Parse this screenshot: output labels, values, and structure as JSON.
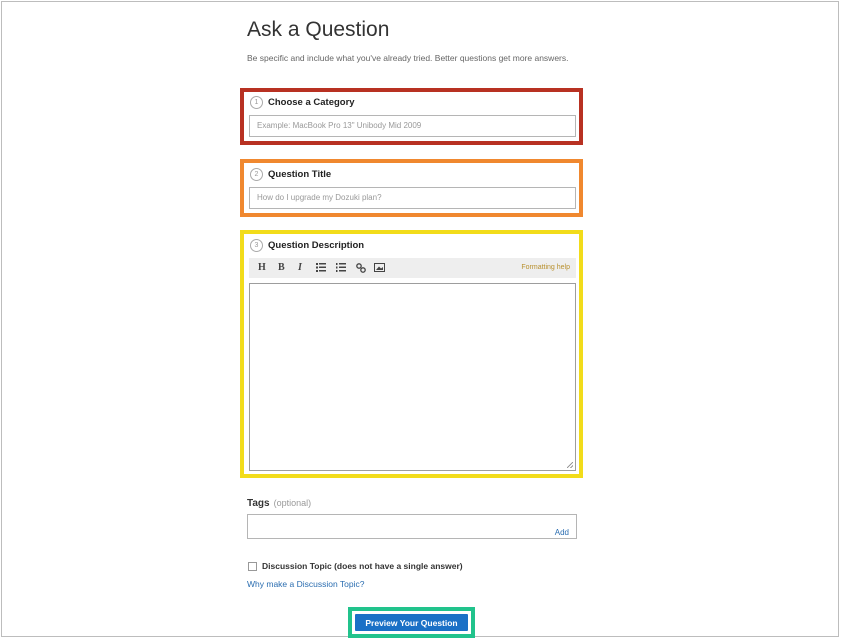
{
  "page": {
    "title": "Ask a Question",
    "subtitle": "Be specific and include what you've already tried. Better questions get more answers."
  },
  "sections": {
    "category": {
      "number": "1",
      "label": "Choose a Category",
      "placeholder": "Example: MacBook Pro 13\" Unibody Mid 2009",
      "highlight_color": "#b83122"
    },
    "title": {
      "number": "2",
      "label": "Question Title",
      "placeholder": "How do I upgrade my Dozuki plan?",
      "highlight_color": "#f0882f"
    },
    "description": {
      "number": "3",
      "label": "Question Description",
      "highlight_color": "#f2dc1a",
      "toolbar": {
        "heading": "H",
        "bold": "B",
        "italic": "I",
        "bullet_list_icon": "bullet-list-icon",
        "numbered_list_icon": "numbered-list-icon",
        "link_icon": "link-icon",
        "image_icon": "image-icon",
        "formatting_help": "Formatting help"
      }
    }
  },
  "tags": {
    "label": "Tags",
    "optional": "(optional)",
    "add": "Add"
  },
  "discussion": {
    "checkbox_label": "Discussion Topic (does not have a single answer)",
    "why_link": "Why make a Discussion Topic?"
  },
  "preview": {
    "label": "Preview Your Question",
    "highlight_color": "#21c38c",
    "button_color": "#1a70c6"
  }
}
